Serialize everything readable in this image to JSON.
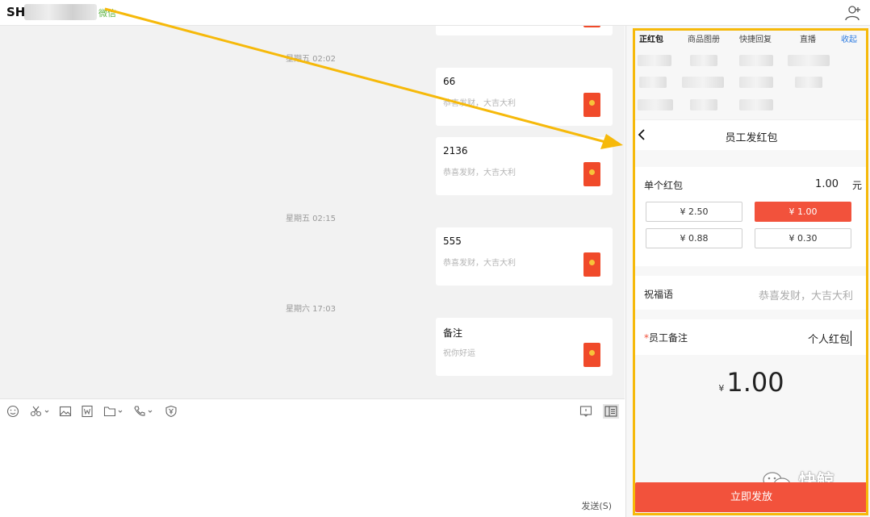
{
  "header": {
    "contact_prefix": "SH",
    "source_tag": "微信"
  },
  "chat": {
    "messages": [
      {
        "amount": "66",
        "wish": "恭喜发财，大吉大利"
      },
      {
        "amount": "2136",
        "wish": "恭喜发财，大吉大利"
      },
      {
        "amount": "555",
        "wish": "恭喜发财，大吉大利"
      },
      {
        "amount": "备注",
        "wish": "祝你好运"
      }
    ],
    "timestamps": [
      "星期五 02:02",
      "星期五 02:15",
      "星期六 17:03"
    ]
  },
  "composer": {
    "send_label": "发送(S)"
  },
  "panel": {
    "tabs": [
      "正红包",
      "商品图册",
      "快捷回复",
      "直播"
    ],
    "collapse_label": "收起",
    "form_title": "员工发红包",
    "single_label": "单个红包",
    "single_value": "1.00",
    "unit": "元",
    "amount_options": [
      "¥ 2.50",
      "¥ 1.00",
      "¥ 0.88",
      "¥ 0.30"
    ],
    "selected_option": "¥ 1.00",
    "blessing_label": "祝福语",
    "blessing_placeholder": "恭喜发财，大吉大利",
    "required_mark": "*",
    "note_label": "员工备注",
    "note_value": "个人红包",
    "total_symbol": "¥",
    "total_amount": "1.00",
    "submit_label": "立即发放",
    "watermark": "快鲸"
  },
  "colors": {
    "accent_red": "#f2523c",
    "highlight": "#f6b90a",
    "link_blue": "#2f7de1",
    "wechat_green": "#5fb545"
  }
}
